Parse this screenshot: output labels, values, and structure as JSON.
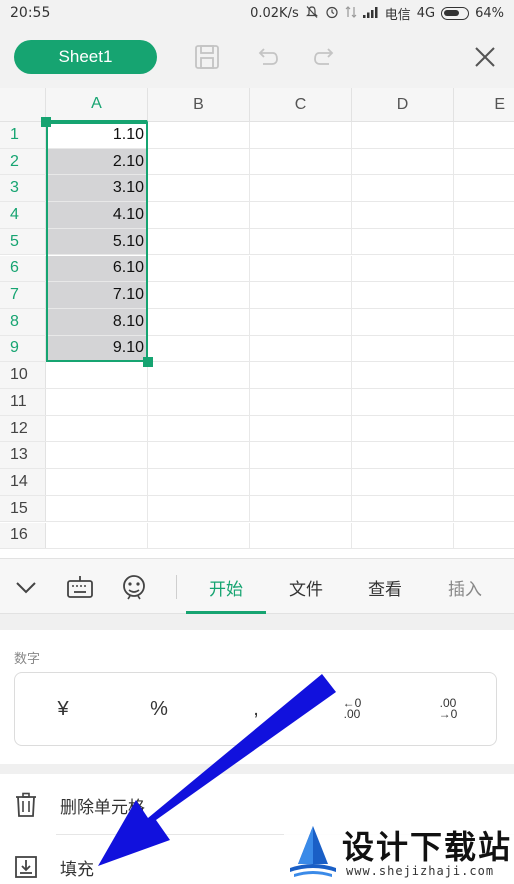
{
  "status_bar": {
    "time": "20:55",
    "speed": "0.02K/s",
    "carrier": "电信",
    "network": "4G",
    "battery": "64%"
  },
  "toolbar": {
    "sheet_name": "Sheet1",
    "icons": [
      "save-icon",
      "undo-icon",
      "redo-icon",
      "close-icon"
    ]
  },
  "grid": {
    "columns": [
      "A",
      "B",
      "C",
      "D",
      "E"
    ],
    "rows": [
      "1",
      "2",
      "3",
      "4",
      "5",
      "6",
      "7",
      "8",
      "9",
      "10",
      "11",
      "12",
      "13",
      "14",
      "15",
      "16"
    ],
    "column_a_values": [
      "1.10",
      "2.10",
      "3.10",
      "4.10",
      "5.10",
      "6.10",
      "7.10",
      "8.10",
      "9.10"
    ],
    "active_column": "A",
    "selection": "A1:A9"
  },
  "tabs": {
    "icons": [
      "chevron-down-icon",
      "keyboard-icon",
      "voice-icon"
    ],
    "items": [
      "开始",
      "文件",
      "查看",
      "插入"
    ],
    "active": "开始"
  },
  "panel": {
    "number_section_label": "数字",
    "format_buttons": {
      "currency": "¥",
      "percent": "%",
      "thousands": ",",
      "increase_decimal_top": "←0",
      "increase_decimal_bottom": ".00",
      "decrease_decimal_top": ".00",
      "decrease_decimal_bottom": "→0"
    },
    "menu_items": [
      {
        "label": "删除单元格",
        "icon": "trash-icon"
      },
      {
        "label": "填充",
        "icon": "fill-down-icon"
      }
    ]
  },
  "watermark": {
    "title": "设计下载站",
    "url": "www.shejizhaji.com"
  },
  "colors": {
    "accent": "#16a471",
    "selection_fill": "#d4d4d6",
    "arrow": "#1111dd"
  }
}
